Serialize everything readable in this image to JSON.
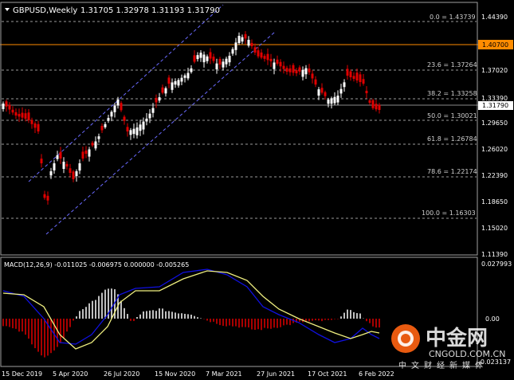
{
  "header": {
    "symbol": "GBPUSD,Weekly",
    "ohlc": "1.31705 1.32978 1.31193 1.31790",
    "collapse_icon": "triangle-down-icon"
  },
  "price_axis": {
    "ticks": [
      "1.44390",
      "1.40700",
      "1.37020",
      "1.33390",
      "1.29650",
      "1.26020",
      "1.22390",
      "1.18650",
      "1.15020",
      "1.11390"
    ],
    "highlight": "1.40700",
    "current": "1.31790"
  },
  "fib_levels": [
    {
      "label": "0.0 = 1.43739"
    },
    {
      "label": "23.6 = 1.37264"
    },
    {
      "label": "38.2 = 1.33258"
    },
    {
      "label": "50.0 = 1.30021"
    },
    {
      "label": "61.8 = 1.26784"
    },
    {
      "label": "78.6 = 1.22174"
    },
    {
      "label": "100.0 = 1.16303"
    }
  ],
  "macd": {
    "label": "MACD(12,26,9) -0.011025 -0.006975 0.000000 -0.005265",
    "ticks": [
      "0.027993",
      "0.00",
      "-0.023137"
    ]
  },
  "time_axis": [
    "15 Dec 2019",
    "5 Apr 2020",
    "26 Jul 2020",
    "15 Nov 2020",
    "7 Mar 2021",
    "27 Jun 2021",
    "17 Oct 2021",
    "6 Feb 2022"
  ],
  "watermark": {
    "brand": "中金网",
    "site": "CNGOLD.COM.CN",
    "slogan": "中文财经新媒体"
  },
  "colors": {
    "bull": "#ffffff",
    "bear": "#e00000",
    "macd_fast": "#1010e0",
    "macd_signal": "#f0f080",
    "highlight_line": "#ff8c00",
    "grid": "#b0b0b0",
    "channel": "#7070ff"
  }
}
